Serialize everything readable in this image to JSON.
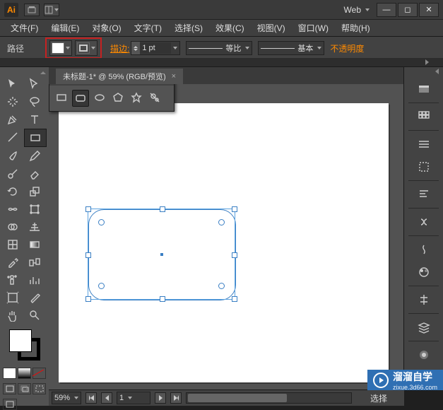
{
  "title_bar": {
    "workspace": "Web"
  },
  "menu": [
    "文件(F)",
    "编辑(E)",
    "对象(O)",
    "文字(T)",
    "选择(S)",
    "效果(C)",
    "视图(V)",
    "窗口(W)",
    "帮助(H)"
  ],
  "control": {
    "path_label": "路径",
    "stroke_label": "描边:",
    "stroke_weight": "1 pt",
    "profile": "等比",
    "brush": "基本",
    "opacity_label": "不透明度"
  },
  "doc_tab": {
    "name": "未标题-1* @ 59% (RGB/预览)"
  },
  "status": {
    "zoom": "59%",
    "artboard": "1",
    "tool": "选择"
  },
  "watermark": {
    "text_main": "溜溜自学",
    "url": "zixue.3d66.com"
  },
  "shape_panel": {
    "tools": [
      "rect",
      "rounded-rect",
      "ellipse",
      "polygon",
      "star",
      "flare"
    ]
  }
}
